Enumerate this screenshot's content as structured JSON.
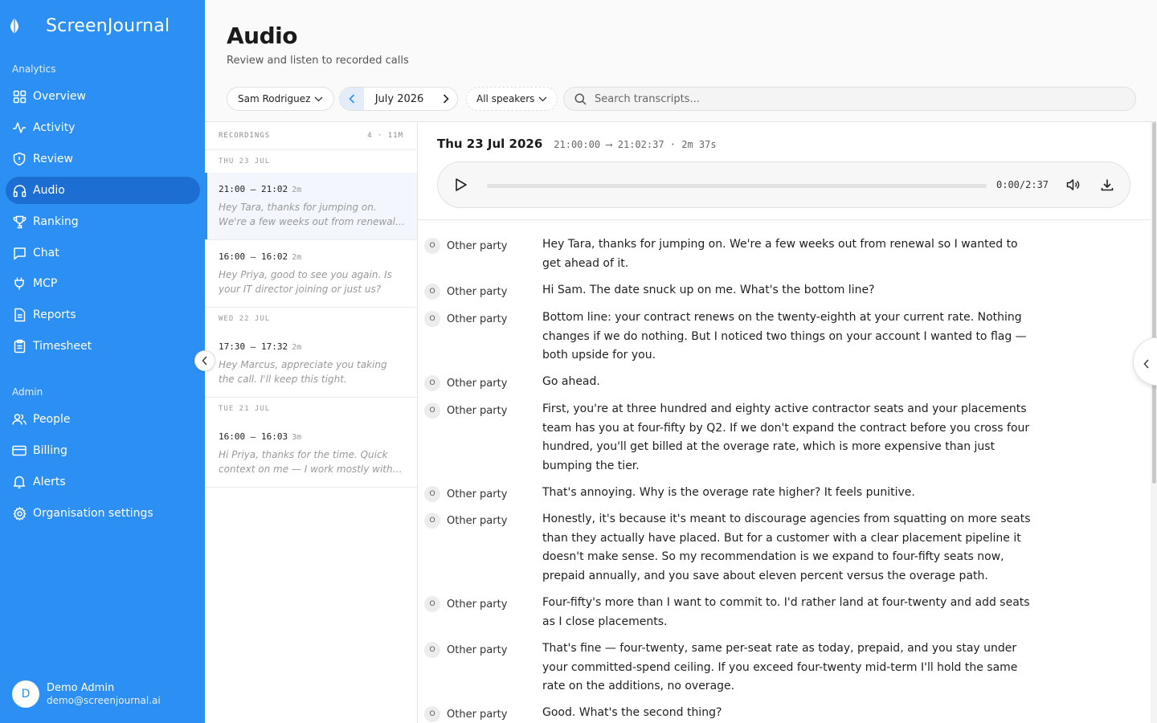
{
  "app": {
    "name": "ScreenJournal"
  },
  "sidebar": {
    "sections": {
      "analytics": "Analytics",
      "admin": "Admin"
    },
    "analytics_items": [
      {
        "label": "Overview",
        "icon": "grid-icon"
      },
      {
        "label": "Activity",
        "icon": "activity-icon"
      },
      {
        "label": "Review",
        "icon": "shield-icon"
      },
      {
        "label": "Audio",
        "icon": "headphones-icon",
        "active": true
      },
      {
        "label": "Ranking",
        "icon": "trophy-icon"
      },
      {
        "label": "Chat",
        "icon": "chat-icon"
      },
      {
        "label": "MCP",
        "icon": "plug-icon"
      },
      {
        "label": "Reports",
        "icon": "report-icon"
      },
      {
        "label": "Timesheet",
        "icon": "clipboard-icon"
      }
    ],
    "admin_items": [
      {
        "label": "People",
        "icon": "people-icon"
      },
      {
        "label": "Billing",
        "icon": "card-icon"
      },
      {
        "label": "Alerts",
        "icon": "bell-icon"
      },
      {
        "label": "Organisation settings",
        "icon": "gear-icon"
      }
    ],
    "user": {
      "initial": "D",
      "name": "Demo Admin",
      "email": "demo@screenjournal.ai"
    }
  },
  "header": {
    "title": "Audio",
    "subtitle": "Review and listen to recorded calls"
  },
  "filters": {
    "person": "Sam Rodriguez",
    "month": "July 2026",
    "speakers": "All speakers",
    "search_placeholder": "Search transcripts..."
  },
  "recordings": {
    "heading": "RECORDINGS",
    "summary": "4 · 11M",
    "groups": [
      {
        "day": "THU 23 JUL",
        "items": [
          {
            "time": "21:00 – 21:02",
            "duration": "2m",
            "snippet": "Hey Tara, thanks for jumping on. We're a few weeks out from renewal so I wanted to get ahead of it.",
            "active": true
          },
          {
            "time": "16:00 – 16:02",
            "duration": "2m",
            "snippet": "Hey Priya, good to see you again. Is your IT director joining or just us?"
          }
        ]
      },
      {
        "day": "WED 22 JUL",
        "items": [
          {
            "time": "17:30 – 17:32",
            "duration": "2m",
            "snippet": "Hey Marcus, appreciate you taking the call. I'll keep this tight."
          }
        ]
      },
      {
        "day": "TUE 21 JUL",
        "items": [
          {
            "time": "16:00 – 16:03",
            "duration": "3m",
            "snippet": "Hi Priya, thanks for the time. Quick context on me — I work mostly with agencies."
          }
        ]
      }
    ]
  },
  "detail": {
    "date": "Thu 23 Jul 2026",
    "meta": "21:00:00 ⟶ 21:02:37 · 2m 37s",
    "player": {
      "time": "0:00/2:37",
      "progress": 0
    },
    "transcript": [
      {
        "badge": "O",
        "speaker": "Other party",
        "text": "Hey Tara, thanks for jumping on. We're a few weeks out from renewal so I wanted to get ahead of it."
      },
      {
        "badge": "O",
        "speaker": "Other party",
        "text": "Hi Sam. The date snuck up on me. What's the bottom line?"
      },
      {
        "badge": "O",
        "speaker": "Other party",
        "text": "Bottom line: your contract renews on the twenty-eighth at your current rate. Nothing changes if we do nothing. But I noticed two things on your account I wanted to flag — both upside for you."
      },
      {
        "badge": "O",
        "speaker": "Other party",
        "text": "Go ahead."
      },
      {
        "badge": "O",
        "speaker": "Other party",
        "text": "First, you're at three hundred and eighty active contractor seats and your placements team has you at four-fifty by Q2. If we don't expand the contract before you cross four hundred, you'll get billed at the overage rate, which is more expensive than just bumping the tier."
      },
      {
        "badge": "O",
        "speaker": "Other party",
        "text": "That's annoying. Why is the overage rate higher? It feels punitive."
      },
      {
        "badge": "O",
        "speaker": "Other party",
        "text": "Honestly, it's because it's meant to discourage agencies from squatting on more seats than they actually have placed. But for a customer with a clear placement pipeline it doesn't make sense. So my recommendation is we expand to four-fifty seats now, prepaid annually, and you save about eleven percent versus the overage path."
      },
      {
        "badge": "O",
        "speaker": "Other party",
        "text": "Four-fifty's more than I want to commit to. I'd rather land at four-twenty and add seats as I close placements."
      },
      {
        "badge": "O",
        "speaker": "Other party",
        "text": "That's fine — four-twenty, same per-seat rate as today, prepaid, and you stay under your committed-spend ceiling. If you exceed four-twenty mid-term I'll hold the same rate on the additions, no overage."
      },
      {
        "badge": "O",
        "speaker": "Other party",
        "text": "Good. What's the second thing?"
      }
    ]
  },
  "colors": {
    "sidebar": "#2b8ff3",
    "active_nav": "#1c6ed3",
    "accent": "#2b8ff3"
  }
}
